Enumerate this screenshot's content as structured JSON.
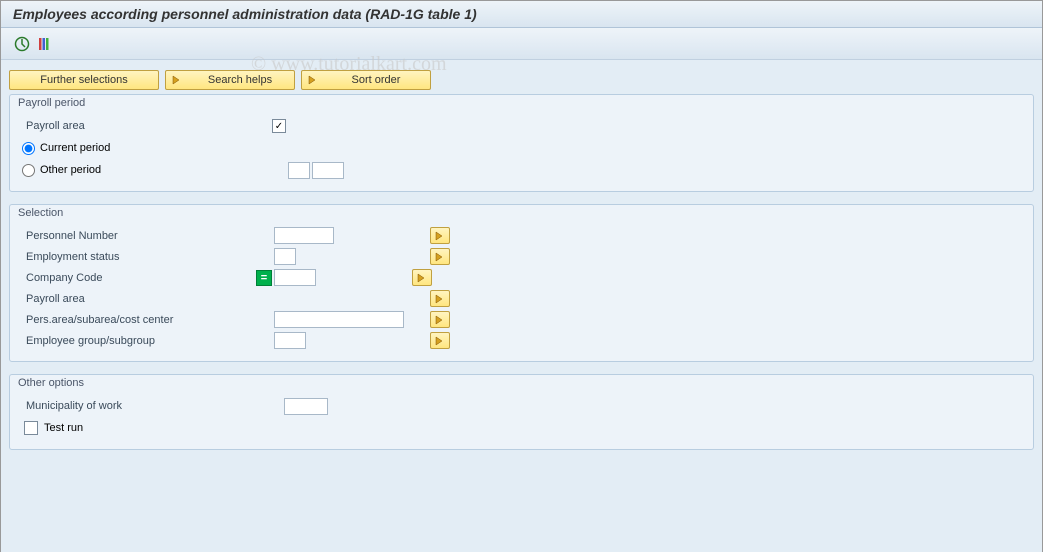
{
  "title": "Employees according personnel administration data (RAD-1G table 1)",
  "watermark": "© www.tutorialkart.com",
  "toolbar_buttons": {
    "further_selections": "Further selections",
    "search_helps": "Search helps",
    "sort_order": "Sort order"
  },
  "groups": {
    "payroll_period": {
      "title": "Payroll period",
      "payroll_area_label": "Payroll area",
      "payroll_area_checked": "☑",
      "current_period": "Current period",
      "other_period": "Other period"
    },
    "selection": {
      "title": "Selection",
      "personnel_number": "Personnel Number",
      "employment_status": "Employment status",
      "company_code": "Company Code",
      "payroll_area": "Payroll area",
      "pers_area": "Pers.area/subarea/cost center",
      "employee_group": "Employee group/subgroup"
    },
    "other_options": {
      "title": "Other options",
      "municipality": "Municipality of work",
      "test_run": "Test run"
    }
  }
}
